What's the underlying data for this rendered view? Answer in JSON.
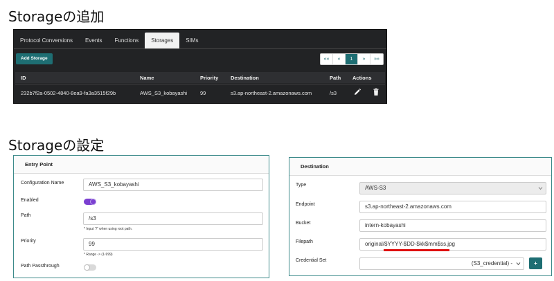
{
  "headings": {
    "add": "Storageの追加",
    "settings": "Storageの設定"
  },
  "tabs": [
    {
      "label": "Protocol Conversions",
      "active": false
    },
    {
      "label": "Events",
      "active": false
    },
    {
      "label": "Functions",
      "active": false
    },
    {
      "label": "Storages",
      "active": true
    },
    {
      "label": "SIMs",
      "active": false
    }
  ],
  "add_button": "Add Storage",
  "pagination": [
    "««",
    "«",
    "1",
    "»",
    "»»"
  ],
  "table": {
    "columns": [
      "ID",
      "Name",
      "Priority",
      "Destination",
      "Path",
      "Actions"
    ],
    "rows": [
      {
        "id": "232b7f2a-0502-4840-8ea9-fa3a3515f29b",
        "name": "AWS_S3_kobayashi",
        "priority": "99",
        "destination": "s3.ap-northeast-2.amazonaws.com",
        "path": "/s3"
      }
    ]
  },
  "entry_point": {
    "title": "Entry Point",
    "configuration_name_label": "Configuration Name",
    "configuration_name": "AWS_S3_kobayashi",
    "enabled_label": "Enabled",
    "enabled": true,
    "path_label": "Path",
    "path": "/s3",
    "path_hint": "* Input \"/\" when using root path.",
    "priority_label": "Priority",
    "priority": "99",
    "priority_hint": "* Range -> (1-999)",
    "passthrough_label": "Path Passthrough",
    "passthrough": false
  },
  "destination": {
    "title": "Destination",
    "type_label": "Type",
    "type": "AWS-S3",
    "endpoint_label": "Endpoint",
    "endpoint": "s3.ap-northeast-2.amazonaws.com",
    "bucket_label": "Bucket",
    "bucket": "intern-kobayashi",
    "filepath_label": "Filepath",
    "filepath": "original/$YYYY-$DD-$kk$mm$ss.jpg",
    "credential_label": "Credential Set",
    "credential": "(S3_credential) -",
    "add_credential": "+"
  },
  "colors": {
    "accent": "#1e6e73",
    "toggle_on": "#7b3fd1",
    "underline": "#e01010"
  },
  "icons": {
    "edit": "pencil-icon",
    "delete": "trash-icon",
    "select": "chevron-down-icon"
  }
}
